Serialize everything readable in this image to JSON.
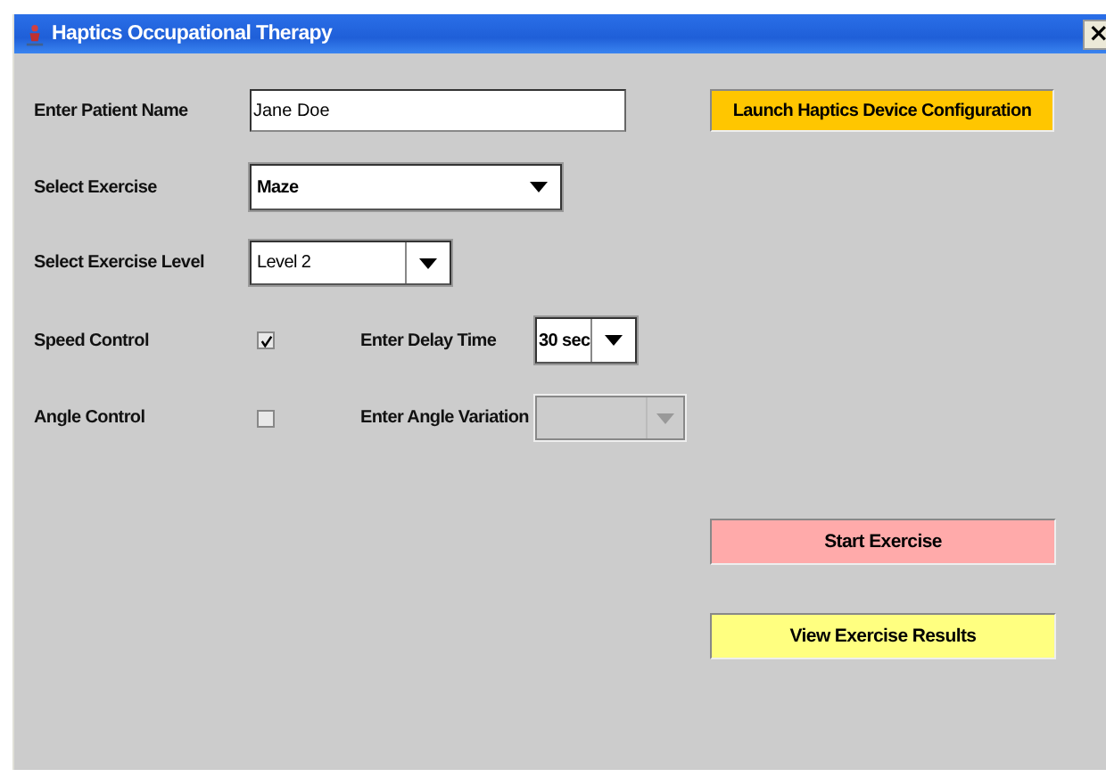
{
  "window": {
    "title": "Haptics Occupational Therapy",
    "close": "×"
  },
  "patient_name": {
    "label": "Enter Patient Name",
    "value": "Jane Doe"
  },
  "launch_button": {
    "label": "Launch Haptics Device Configuration",
    "color": "#ffc600"
  },
  "exercise": {
    "label": "Select Exercise",
    "value": "Maze",
    "disabled": false
  },
  "level": {
    "label": "Select Exercise Level",
    "value": "Level 2",
    "disabled": false
  },
  "speed_control": {
    "label": "Speed Control",
    "checked": true
  },
  "delay_time": {
    "label": "Enter Delay Time",
    "value": "30 sec",
    "disabled": false
  },
  "angle_control": {
    "label": "Angle Control",
    "checked": false
  },
  "angle_variation": {
    "label": "Enter Angle Variation",
    "disabled": true
  },
  "buttons": [
    {
      "label": "Start Exercise",
      "color": "#ffaaaa"
    },
    {
      "label": "View Exercise Results",
      "color": "#ffff80"
    }
  ]
}
